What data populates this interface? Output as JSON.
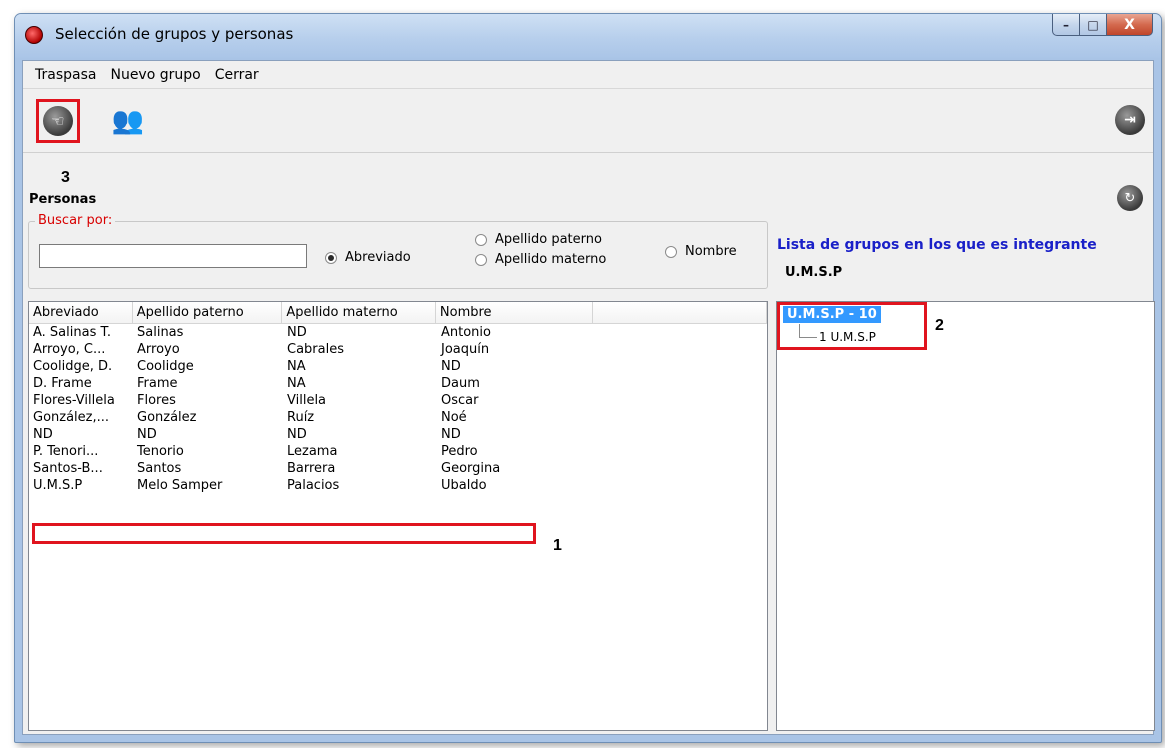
{
  "window": {
    "title": "Selección de grupos y personas",
    "buttons": {
      "minimize": "–",
      "maximize": "□",
      "close": "X"
    }
  },
  "menu": [
    "Traspasa",
    "Nuevo grupo",
    "Cerrar"
  ],
  "toolbar": {
    "traspasa_icon": "pointing-hand-icon",
    "group_icon": "people-icon",
    "exit_icon": "exit-door-icon",
    "refresh_icon": "refresh-icon"
  },
  "callouts": {
    "one": "1",
    "two": "2",
    "three": "3"
  },
  "personas": {
    "label": "Personas",
    "search_label": "Buscar por:",
    "search_value": "",
    "radios": {
      "abreviado": "Abreviado",
      "apellido_paterno": "Apellido paterno",
      "apellido_materno": "Apellido materno",
      "nombre": "Nombre"
    },
    "selected_radio": "Abreviado"
  },
  "groups": {
    "title": "Lista de grupos en los que es integrante",
    "value": "U.M.S.P",
    "tree_root": "U.M.S.P - 10",
    "tree_child": "1 U.M.S.P"
  },
  "table": {
    "columns": [
      "Abreviado",
      "Apellido paterno",
      "Apellido materno",
      "Nombre",
      ""
    ],
    "rows": [
      [
        "A. Salinas T.",
        "Salinas",
        "ND",
        "Antonio"
      ],
      [
        "Arroyo, C...",
        "Arroyo",
        "Cabrales",
        "Joaquín"
      ],
      [
        "Coolidge, D.",
        "Coolidge",
        "NA",
        "ND"
      ],
      [
        "D. Frame",
        "Frame",
        "NA",
        "Daum"
      ],
      [
        "Flores-Villela",
        "Flores",
        "Villela",
        "Oscar"
      ],
      [
        "González,...",
        "González",
        "Ruíz",
        "Noé"
      ],
      [
        "ND",
        "ND",
        "ND",
        "ND"
      ],
      [
        "P. Tenori...",
        "Tenorio",
        "Lezama",
        "Pedro"
      ],
      [
        "Santos-B...",
        "Santos",
        "Barrera",
        "Georgina"
      ],
      [
        "U.M.S.P",
        "Melo Samper",
        "Palacios",
        "Ubaldo"
      ]
    ]
  },
  "colors": {
    "highlight_box": "#e0141e",
    "selection": "#3399ff",
    "group_title": "#1a20c8"
  }
}
